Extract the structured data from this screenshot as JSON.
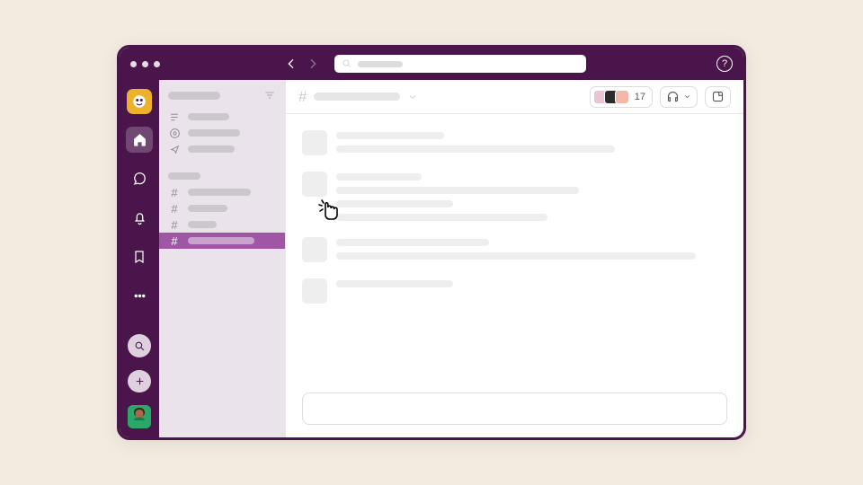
{
  "header": {
    "member_count": "17"
  },
  "colors": {
    "brand": "#4a154b",
    "accent": "#9f57a5",
    "workspace": "#ecb22e",
    "bg": "#f2ebdf"
  },
  "faces": [
    "#e8c4d4",
    "#2b2b2b",
    "#f5b8a8"
  ]
}
